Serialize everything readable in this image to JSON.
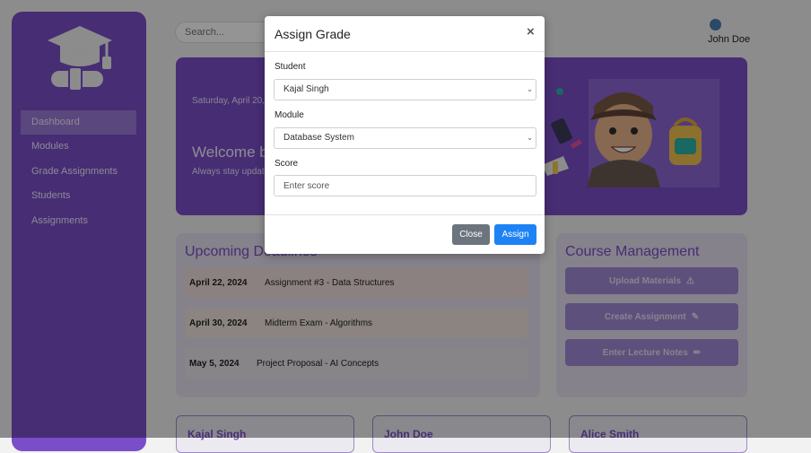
{
  "sidebar": {
    "logo_icon": "graduation-cap-icon",
    "items": [
      {
        "label": "Dashboard",
        "active": true
      },
      {
        "label": "Modules",
        "active": false
      },
      {
        "label": "Grade Assignments",
        "active": false
      },
      {
        "label": "Students",
        "active": false
      },
      {
        "label": "Assignments",
        "active": false
      }
    ]
  },
  "header": {
    "search_placeholder": "Search...",
    "user_name": "John Doe",
    "user_icon": "user-avatar-icon"
  },
  "hero": {
    "date": "Saturday, April 20,",
    "welcome": "Welcome b",
    "subtitle": "Always stay updat"
  },
  "deadlines": {
    "title": "Upcoming Deadlines",
    "items": [
      {
        "date": "April 22, 2024",
        "task": "Assignment #3 - Data Structures",
        "color": "#f1dedf"
      },
      {
        "date": "April 30, 2024",
        "task": "Midterm Exam - Algorithms",
        "color": "#efe4df"
      },
      {
        "date": "May 5, 2024",
        "task": "Project Proposal - AI Concepts",
        "color": "#e8e6e8"
      }
    ]
  },
  "course_management": {
    "title": "Course Management",
    "buttons": [
      {
        "label": "Upload Materials",
        "icon": "warning-icon",
        "glyph": "⚠"
      },
      {
        "label": "Create Assignment",
        "icon": "edit-box-icon",
        "glyph": "✎"
      },
      {
        "label": "Enter Lecture Notes",
        "icon": "pencil-icon",
        "glyph": "✏"
      }
    ]
  },
  "students": [
    {
      "name": "Kajal Singh"
    },
    {
      "name": "John Doe"
    },
    {
      "name": "Alice Smith"
    }
  ],
  "modal": {
    "title": "Assign Grade",
    "close_glyph": "×",
    "student_label": "Student",
    "student_value": "Kajal Singh",
    "module_label": "Module",
    "module_value": "Database System",
    "score_label": "Score",
    "score_placeholder": "Enter score",
    "close_button": "Close",
    "assign_button": "Assign"
  },
  "colors": {
    "accent": "#7a4ec8",
    "primary_button": "#1d83f5",
    "secondary_button": "#6c757d"
  }
}
